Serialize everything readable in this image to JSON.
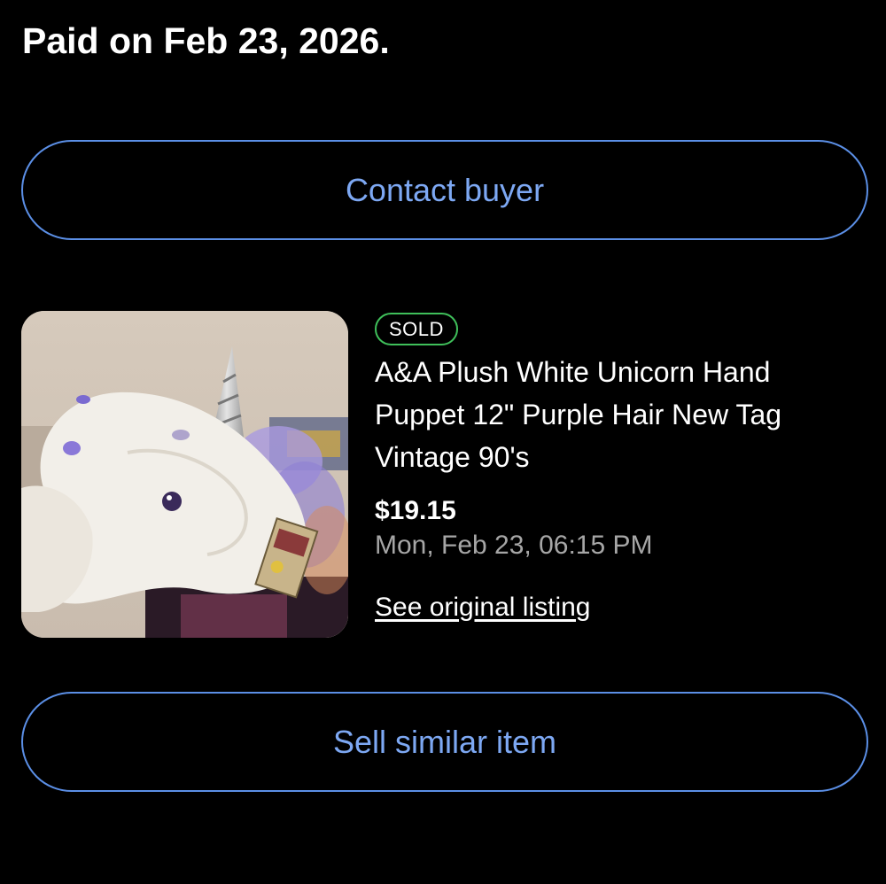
{
  "order": {
    "paid_status": "Paid on Feb 23, 2026."
  },
  "actions": {
    "contact_buyer_label": "Contact buyer",
    "sell_similar_label": "Sell similar item"
  },
  "item": {
    "status_badge": "SOLD",
    "title": "A&A Plush White Unicorn Hand Puppet 12\" Purple Hair New Tag Vintage 90's",
    "price": "$19.15",
    "sold_date": "Mon, Feb 23, 06:15 PM",
    "listing_link_label": "See original listing",
    "image_alt": "White plush unicorn hand puppet with purple hair"
  },
  "colors": {
    "background": "#000000",
    "accent_blue": "#5b8fe6",
    "sold_green": "#3fbf5a",
    "muted_text": "#a6a6a6"
  }
}
